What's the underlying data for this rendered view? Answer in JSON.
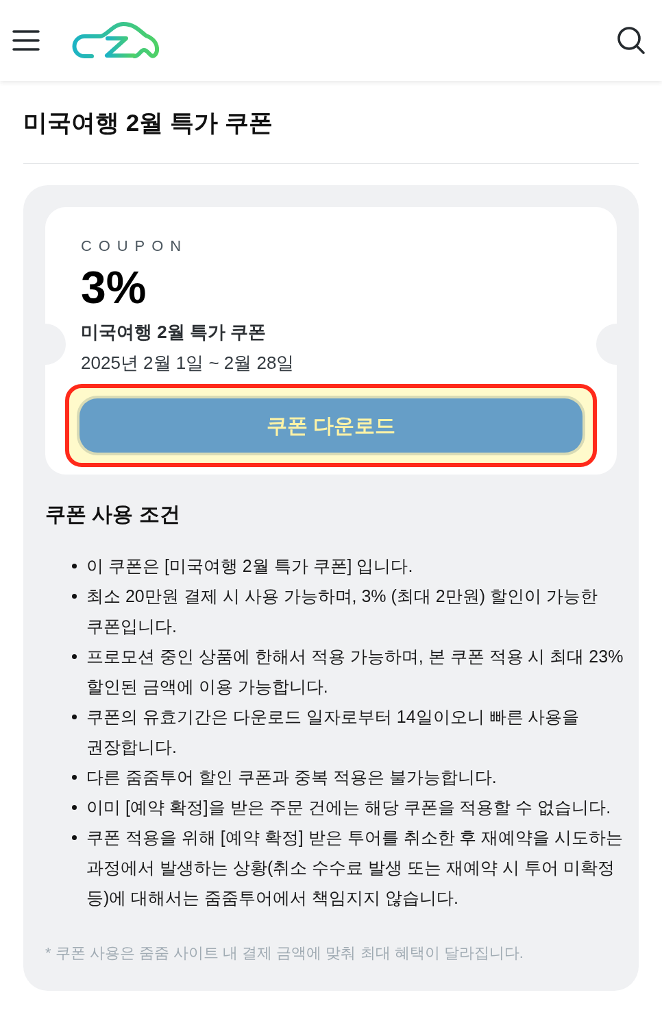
{
  "page": {
    "title": "미국여행 2월 특가 쿠폰"
  },
  "coupon": {
    "label": "COUPON",
    "discount": "3%",
    "name": "미국여행 2월 특가 쿠폰",
    "period": "2025년 2월 1일 ~ 2월 28일",
    "download_button": "쿠폰 다운로드",
    "highlighted": true
  },
  "conditions": {
    "heading": "쿠폰 사용 조건",
    "items": [
      "이 쿠폰은 [미국여행 2월 특가 쿠폰] 입니다.",
      "최소 20만원 결제 시 사용 가능하며, 3% (최대 2만원) 할인이 가능한 쿠폰입니다.",
      "프로모션 중인 상품에 한해서 적용 가능하며, 본 쿠폰 적용 시 최대 23% 할인된 금액에 이용 가능합니다.",
      "쿠폰의 유효기간은 다운로드 일자로부터 14일이오니 빠른 사용을 권장합니다.",
      "다른 줌줌투어 할인 쿠폰과 중복 적용은 불가능합니다.",
      "이미 [예약 확정]을 받은 주문 건에는 해당 쿠폰을 적용할 수 없습니다.",
      "쿠폰 적용을 위해 [예약 확정] 받은 투어를 취소한 후 재예약을 시도하는 과정에서 발생하는 상황(취소 수수료 발생 또는 재예약 시 투어 미확정 등)에 대해서는 줌줌투어에서 책임지지 않습니다."
    ]
  },
  "footnote": "* 쿠폰 사용은 줌줌 사이트 내 결제 금액에 맞춰 최대 혜택이 달라집니다."
}
